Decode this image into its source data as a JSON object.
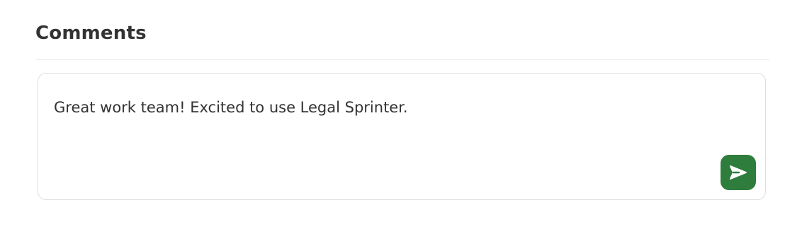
{
  "comments": {
    "title": "Comments",
    "input_value": "Great work team! Excited to use Legal Sprinter.",
    "send_icon": "send-icon"
  },
  "colors": {
    "accent": "#2e7d3c",
    "text": "#333333",
    "border": "#dedede"
  }
}
